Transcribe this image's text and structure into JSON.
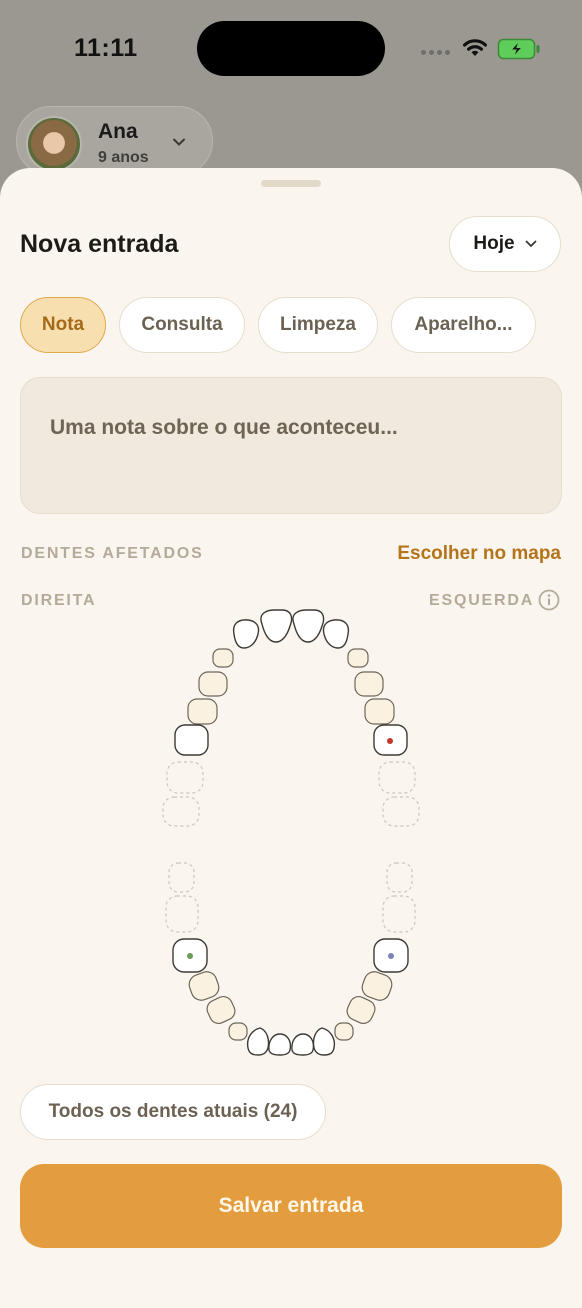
{
  "status_bar": {
    "time": "11:11",
    "battery_charging": true
  },
  "profile": {
    "name": "Ana",
    "age": "9 anos"
  },
  "sheet": {
    "title": "Nova entrada",
    "date_selector": {
      "label": "Hoje"
    },
    "entry_types": [
      {
        "label": "Nota",
        "selected": true
      },
      {
        "label": "Consulta",
        "selected": false
      },
      {
        "label": "Limpeza",
        "selected": false
      },
      {
        "label": "Aparelho...",
        "selected": false
      }
    ],
    "note": {
      "placeholder": "Uma nota sobre o que aconteceu..."
    },
    "affected_teeth": {
      "label": "DENTES AFETADOS",
      "choose_link": "Escolher no mapa",
      "right_label": "DIREITA",
      "left_label": "ESQUERDA"
    },
    "all_teeth_button": "Todos os dentes atuais (24)",
    "save_button": "Salvar entrada"
  },
  "colors": {
    "accent": "#e39d3e",
    "selected_chip_bg": "#f8dfb0",
    "marker_red": "#c0392b",
    "marker_green": "#6e9a5a",
    "marker_blue": "#7b84b8"
  },
  "icons": {
    "wifi": "wifi-icon",
    "battery": "battery-charging-icon",
    "chevron": "chevron-down-icon",
    "info": "info-icon"
  }
}
